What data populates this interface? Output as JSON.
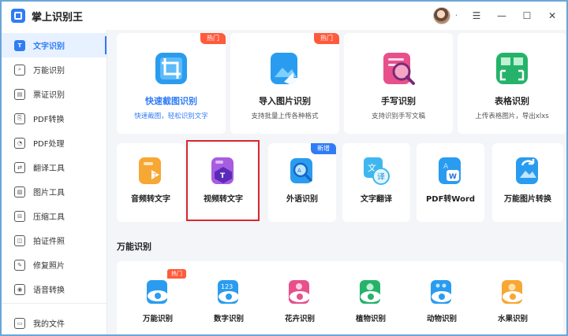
{
  "app": {
    "title": "掌上识别王"
  },
  "window_controls": {
    "dot": "·",
    "menu": "☰",
    "minimize": "—",
    "maximize": "☐",
    "close": "✕"
  },
  "sidebar": {
    "items": [
      {
        "label": "文字识别",
        "icon": "T",
        "active": true
      },
      {
        "label": "万能识别",
        "icon": "⌕"
      },
      {
        "label": "票证识别",
        "icon": "▤"
      },
      {
        "label": "PDF转换",
        "icon": "⎘"
      },
      {
        "label": "PDF处理",
        "icon": "◔"
      },
      {
        "label": "翻译工具",
        "icon": "⇄"
      },
      {
        "label": "图片工具",
        "icon": "▨"
      },
      {
        "label": "压缩工具",
        "icon": "⊟"
      },
      {
        "label": "拍证件照",
        "icon": "◫"
      },
      {
        "label": "修复照片",
        "icon": "✎"
      },
      {
        "label": "语音转换",
        "icon": "◉"
      }
    ],
    "bottom": {
      "label": "我的文件",
      "icon": "▭"
    }
  },
  "big_cards": [
    {
      "title": "快速截图识别",
      "sub": "快速截图，轻松识别文字",
      "badge": "热门",
      "selected": true
    },
    {
      "title": "导入图片识别",
      "sub": "支持批量上传各种格式",
      "badge": "热门"
    },
    {
      "title": "手写识别",
      "sub": "支持识别手写文稿"
    },
    {
      "title": "表格识别",
      "sub": "上传表格图片，导出xlxs"
    }
  ],
  "mid_cards": [
    {
      "title": "音频转文字"
    },
    {
      "title": "视频转文字"
    },
    {
      "title": "外语识别",
      "badge": "新增"
    },
    {
      "title": "文字翻译"
    },
    {
      "title": "PDF转Word"
    },
    {
      "title": "万能图片转换"
    }
  ],
  "section": {
    "title": "万能识别"
  },
  "small_items": [
    {
      "title": "万能识别",
      "badge": "热门"
    },
    {
      "title": "数字识别",
      "glyph": "123"
    },
    {
      "title": "花卉识别"
    },
    {
      "title": "植物识别"
    },
    {
      "title": "动物识别"
    },
    {
      "title": "水果识别"
    }
  ],
  "colors": {
    "accent": "#2f7cf6",
    "hot": "#ff5a3c",
    "highlight": "#d7282e"
  }
}
